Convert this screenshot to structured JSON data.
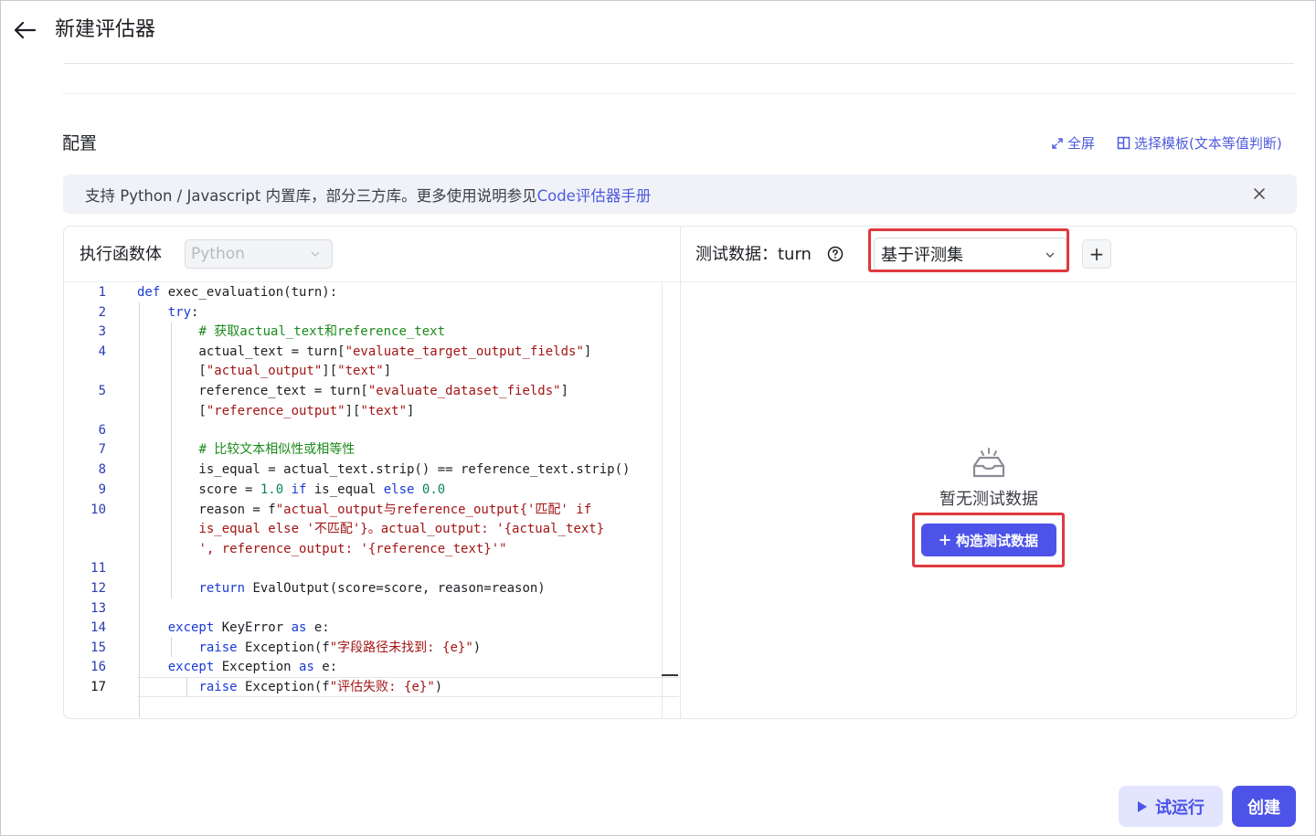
{
  "header": {
    "title": "新建评估器"
  },
  "config": {
    "title": "配置",
    "fullscreen_label": "全屏",
    "template_label": "选择模板(文本等值判断)"
  },
  "notice": {
    "text": "支持 Python / Javascript 内置库，部分三方库。更多使用说明参见",
    "link": "Code评估器手册"
  },
  "editor": {
    "label": "执行函数体",
    "language": "Python",
    "line_numbers": [
      "1",
      "2",
      "3",
      "4",
      "5",
      "6",
      "7",
      "8",
      "9",
      "10",
      "11",
      "12",
      "13",
      "14",
      "15",
      "16",
      "17"
    ],
    "current_line": "17"
  },
  "test": {
    "label": "测试数据：turn",
    "dataset_source": "基于评测集",
    "add_label": "+",
    "empty_text": "暂无测试数据",
    "build_label": "构造测试数据"
  },
  "footer": {
    "run_label": "试运行",
    "create_label": "创建"
  },
  "colors": {
    "accent": "#4d53e8",
    "link": "#4e5bdc",
    "highlight_box": "#e0393e"
  }
}
